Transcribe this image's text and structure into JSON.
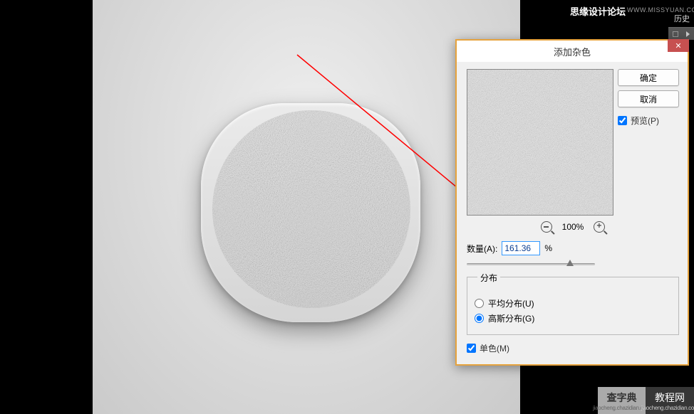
{
  "header": {
    "brand_text": "思缘设计论坛",
    "url_text": "WWW.MISSYUAN.COM",
    "history_label": "历史"
  },
  "dialog": {
    "title": "添加杂色",
    "ok_label": "确定",
    "cancel_label": "取消",
    "preview_label": "预览(P)",
    "preview_checked": true,
    "zoom_text": "100%",
    "amount_label": "数量(A):",
    "amount_value": "161.36",
    "amount_unit": "%",
    "distribution": {
      "legend": "分布",
      "uniform_label": "平均分布(U)",
      "gaussian_label": "高斯分布(G)",
      "selected": "gaussian"
    },
    "mono_label": "单色(M)",
    "mono_checked": true
  },
  "watermark": {
    "left_main": "查字典",
    "left_sub": "jiaocheng.chazidian.com",
    "right_main": "教程网"
  }
}
